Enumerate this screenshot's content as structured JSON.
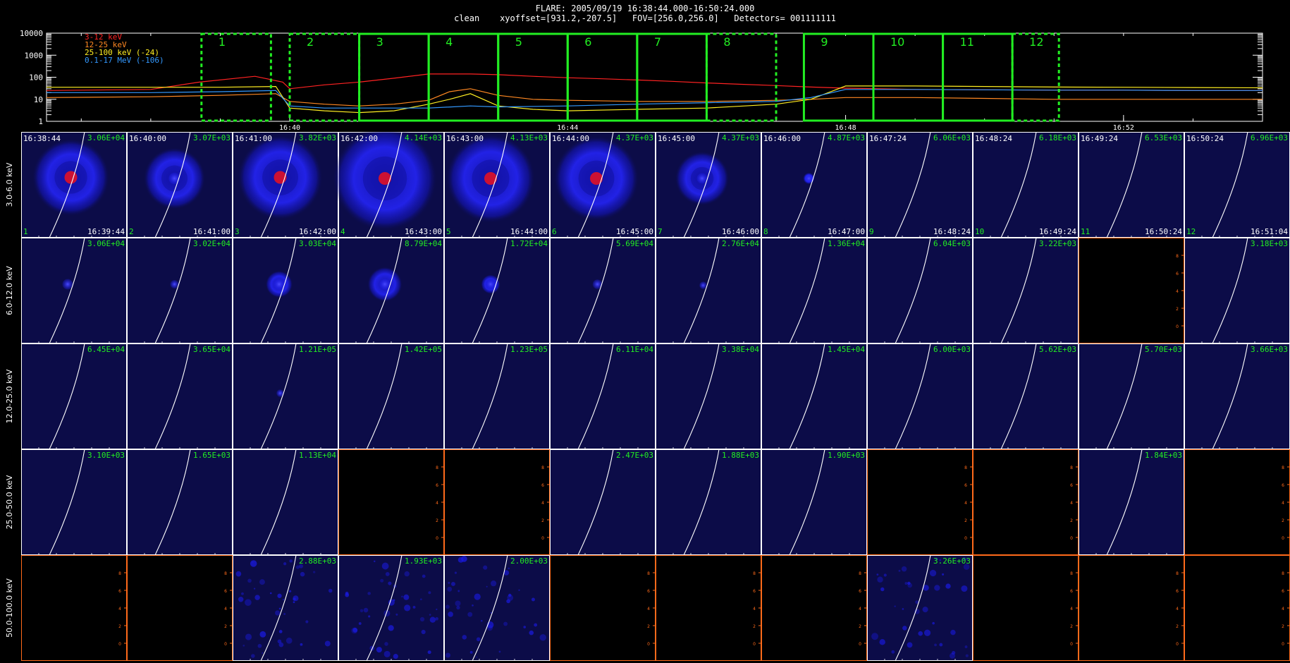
{
  "header": {
    "title_line1": "FLARE: 2005/09/19 16:38:44.000-16:50:24.000",
    "title_line2": "clean    xyoffset=[931.2,-207.5]   FOV=[256.0,256.0]   Detectors= 001111111"
  },
  "colors": {
    "background": "#000000",
    "window_green": "#22ee22",
    "panel_bg": "#0c0c48",
    "empty_panel_axis": "#ff6a1a",
    "limb": "#ffffff",
    "source_blue": "#2222ff",
    "source_red": "#cc1133",
    "max_label": "#22ee22"
  },
  "chart_data": [
    {
      "type": "line",
      "title": "",
      "xlabel": "",
      "ylabel": "",
      "y_scale": "log",
      "ylim": [
        1,
        10000
      ],
      "y_ticks": [
        "10000",
        "1000",
        "100",
        "10",
        "1"
      ],
      "x_ticks": [
        "16:40",
        "16:44",
        "16:48",
        "16:52"
      ],
      "x_tick_minutes": [
        40,
        44,
        48,
        52
      ],
      "xlim_minutes": [
        36.5,
        54.0
      ],
      "legend": [
        {
          "label": "3-12 keV",
          "color": "#ff2222"
        },
        {
          "label": "12-25 keV",
          "color": "#ff8822"
        },
        {
          "label": "25-100 keV (-24)",
          "color": "#ffee22"
        },
        {
          "label": "0.1-17 MeV (-106)",
          "color": "#3399ff"
        }
      ],
      "series": [
        {
          "name": "3-12 keV",
          "color": "#ff2222",
          "x": [
            36.5,
            38.0,
            38.7,
            39.5,
            39.9,
            40.0,
            40.5,
            41.0,
            41.5,
            42.0,
            42.6,
            43.0,
            43.5,
            44.0,
            44.5,
            45.0,
            45.5,
            46.0,
            46.5,
            47.0,
            47.5,
            48.0,
            48.5,
            49.0,
            50.0,
            51.0,
            52.0,
            53.0,
            54.0
          ],
          "y": [
            25,
            28,
            60,
            110,
            60,
            30,
            45,
            60,
            90,
            140,
            140,
            130,
            110,
            95,
            85,
            75,
            65,
            55,
            48,
            42,
            36,
            32,
            30,
            28,
            27,
            26,
            26,
            25,
            25
          ]
        },
        {
          "name": "12-25 keV",
          "color": "#ff8822",
          "x": [
            36.5,
            38.0,
            39.0,
            39.8,
            40.0,
            40.5,
            41.0,
            41.5,
            42.0,
            42.3,
            42.6,
            43.0,
            43.5,
            44.0,
            45.0,
            46.0,
            47.0,
            47.5,
            48.0,
            49.0,
            50.0,
            51.0,
            52.0,
            53.0,
            54.0
          ],
          "y": [
            12,
            13,
            15,
            18,
            8,
            6,
            5,
            6,
            9,
            22,
            30,
            15,
            10,
            9,
            8,
            8,
            9,
            10,
            12,
            12,
            11,
            10,
            10,
            10,
            10
          ]
        },
        {
          "name": "25-100 keV (-24)",
          "color": "#ffee22",
          "x": [
            36.5,
            38.0,
            39.0,
            39.8,
            40.0,
            40.5,
            41.0,
            41.5,
            42.0,
            42.3,
            42.6,
            43.0,
            43.5,
            44.0,
            45.0,
            46.0,
            47.0,
            47.5,
            48.0,
            49.0,
            50.0,
            51.0,
            52.0,
            53.0,
            54.0
          ],
          "y": [
            35,
            35,
            35,
            38,
            4,
            3,
            2.5,
            3,
            6,
            10,
            18,
            5,
            3.5,
            3,
            3.5,
            4,
            6,
            10,
            40,
            40,
            38,
            36,
            35,
            34,
            33
          ]
        },
        {
          "name": "0.1-17 MeV (-106)",
          "color": "#3399ff",
          "x": [
            36.5,
            38.0,
            39.0,
            39.8,
            40.0,
            40.5,
            41.0,
            41.5,
            42.0,
            42.6,
            43.0,
            44.0,
            45.0,
            46.0,
            47.0,
            47.5,
            48.0,
            49.0,
            50.0,
            51.0,
            52.0,
            53.0,
            54.0
          ],
          "y": [
            20,
            20,
            22,
            25,
            5,
            4,
            4,
            4,
            4,
            5,
            4.5,
            5,
            6,
            7,
            8,
            12,
            28,
            28,
            27,
            26,
            26,
            25,
            25
          ]
        }
      ],
      "windows": [
        {
          "label": "1",
          "start": 38.73,
          "end": 39.73,
          "style": "dashed"
        },
        {
          "label": "2",
          "start": 40.0,
          "end": 41.0,
          "style": "dashed"
        },
        {
          "label": "3",
          "start": 41.0,
          "end": 42.0,
          "style": "solid"
        },
        {
          "label": "4",
          "start": 42.0,
          "end": 43.0,
          "style": "solid"
        },
        {
          "label": "5",
          "start": 43.0,
          "end": 44.0,
          "style": "solid"
        },
        {
          "label": "6",
          "start": 44.0,
          "end": 45.0,
          "style": "solid"
        },
        {
          "label": "7",
          "start": 45.0,
          "end": 46.0,
          "style": "solid"
        },
        {
          "label": "8",
          "start": 46.0,
          "end": 47.0,
          "style": "dashed"
        },
        {
          "label": "9",
          "start": 47.4,
          "end": 48.4,
          "style": "solid"
        },
        {
          "label": "10",
          "start": 48.4,
          "end": 49.4,
          "style": "solid"
        },
        {
          "label": "11",
          "start": 49.4,
          "end": 50.4,
          "style": "solid"
        },
        {
          "label": "12",
          "start": 50.4,
          "end": 51.07,
          "style": "dashed"
        }
      ]
    },
    {
      "type": "heatmap",
      "title": "",
      "row_labels": [
        "3.0-6.0 keV",
        "6.0-12.0 keV",
        "12.0-25.0 keV",
        "25.0-50.0 keV",
        "50.0-100.0 keV"
      ],
      "start_times": [
        "16:38:44",
        "16:40:00",
        "16:41:00",
        "16:42:00",
        "16:43:00",
        "16:44:00",
        "16:45:00",
        "16:46:00",
        "16:47:24",
        "16:48:24",
        "16:49:24",
        "16:50:24"
      ],
      "end_times": [
        "16:39:44",
        "16:41:00",
        "16:42:00",
        "16:43:00",
        "16:44:00",
        "16:45:00",
        "16:46:00",
        "16:47:00",
        "16:48:24",
        "16:49:24",
        "16:50:24",
        "16:51:04"
      ],
      "index_labels": [
        "1",
        "2",
        "3",
        "4",
        "5",
        "6",
        "7",
        "8",
        "9",
        "10",
        "11",
        "12"
      ],
      "max_values": [
        [
          "3.06E+04",
          "3.07E+03",
          "3.82E+03",
          "4.14E+03",
          "4.13E+03",
          "4.37E+03",
          "4.37E+03",
          "4.87E+03",
          "6.06E+03",
          "6.18E+03",
          "6.53E+03",
          "6.96E+03"
        ],
        [
          "3.06E+04",
          "3.02E+04",
          "3.03E+04",
          "8.79E+04",
          "1.72E+04",
          "5.69E+04",
          "2.76E+04",
          "1.36E+04",
          "6.04E+03",
          "3.22E+03",
          "",
          "3.18E+03"
        ],
        [
          "6.45E+04",
          "3.65E+04",
          "1.21E+05",
          "1.42E+05",
          "1.23E+05",
          "6.11E+04",
          "3.38E+04",
          "1.45E+04",
          "6.00E+03",
          "5.62E+03",
          "5.70E+03",
          "3.66E+03"
        ],
        [
          "3.10E+03",
          "1.65E+03",
          "1.13E+04",
          "",
          "",
          "2.47E+03",
          "1.88E+03",
          "1.90E+03",
          "",
          "",
          "1.84E+03",
          ""
        ],
        [
          "",
          "",
          "2.88E+03",
          "1.93E+03",
          "2.00E+03",
          "",
          "",
          "",
          "3.26E+03",
          "",
          "",
          ""
        ]
      ],
      "empty_cells": [
        [
          1,
          10
        ],
        [
          3,
          3
        ],
        [
          3,
          4
        ],
        [
          3,
          8
        ],
        [
          3,
          9
        ],
        [
          3,
          11
        ],
        [
          4,
          0
        ],
        [
          4,
          1
        ],
        [
          4,
          5
        ],
        [
          4,
          6
        ],
        [
          4,
          7
        ],
        [
          4,
          9
        ],
        [
          4,
          10
        ],
        [
          4,
          11
        ]
      ],
      "sources": [
        {
          "row": 0,
          "col": 0,
          "x": 0.47,
          "y": 0.43,
          "r": 0.06,
          "color": "red",
          "ring": 1.0
        },
        {
          "row": 0,
          "col": 1,
          "x": 0.45,
          "y": 0.44,
          "r": 0.055,
          "color": "blue",
          "ring": 0.8
        },
        {
          "row": 0,
          "col": 2,
          "x": 0.45,
          "y": 0.43,
          "r": 0.06,
          "color": "red",
          "ring": 1.1
        },
        {
          "row": 0,
          "col": 3,
          "x": 0.44,
          "y": 0.44,
          "r": 0.06,
          "color": "red",
          "ring": 1.35
        },
        {
          "row": 0,
          "col": 4,
          "x": 0.44,
          "y": 0.44,
          "r": 0.06,
          "color": "red",
          "ring": 1.15
        },
        {
          "row": 0,
          "col": 5,
          "x": 0.44,
          "y": 0.44,
          "r": 0.06,
          "color": "red",
          "ring": 1.1
        },
        {
          "row": 0,
          "col": 6,
          "x": 0.44,
          "y": 0.44,
          "r": 0.05,
          "color": "blue",
          "ring": 0.7
        },
        {
          "row": 0,
          "col": 7,
          "x": 0.45,
          "y": 0.44,
          "r": 0.04,
          "color": "blue",
          "ring": 0.15
        },
        {
          "row": 1,
          "col": 0,
          "x": 0.44,
          "y": 0.44,
          "r": 0.05,
          "color": "blue",
          "ring": 0.0
        },
        {
          "row": 1,
          "col": 1,
          "x": 0.45,
          "y": 0.44,
          "r": 0.04,
          "color": "blue",
          "ring": 0.0
        },
        {
          "row": 1,
          "col": 2,
          "x": 0.44,
          "y": 0.44,
          "r": 0.05,
          "color": "blue",
          "ring": 0.35
        },
        {
          "row": 1,
          "col": 3,
          "x": 0.44,
          "y": 0.44,
          "r": 0.05,
          "color": "blue",
          "ring": 0.45
        },
        {
          "row": 1,
          "col": 4,
          "x": 0.44,
          "y": 0.44,
          "r": 0.045,
          "color": "blue",
          "ring": 0.25
        },
        {
          "row": 1,
          "col": 5,
          "x": 0.45,
          "y": 0.44,
          "r": 0.045,
          "color": "blue",
          "ring": 0.0
        },
        {
          "row": 1,
          "col": 6,
          "x": 0.45,
          "y": 0.45,
          "r": 0.035,
          "color": "blue",
          "ring": 0.0
        },
        {
          "row": 2,
          "col": 2,
          "x": 0.45,
          "y": 0.47,
          "r": 0.035,
          "color": "blue",
          "ring": 0.0
        }
      ],
      "noisy_cells": [
        [
          4,
          2
        ],
        [
          4,
          3
        ],
        [
          4,
          4
        ],
        [
          4,
          8
        ]
      ]
    }
  ]
}
